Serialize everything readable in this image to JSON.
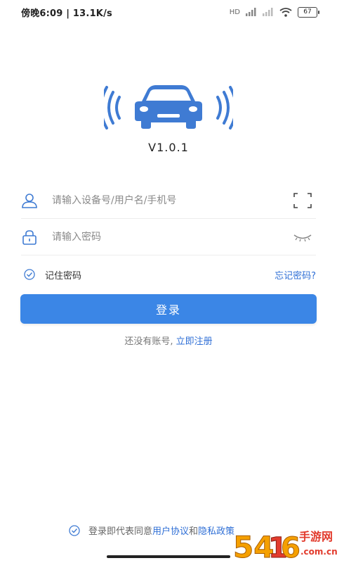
{
  "status_bar": {
    "left_text": "傍晚6:09 | 13.1K/s",
    "network_label": "HD",
    "battery_level": "67"
  },
  "app": {
    "version": "V1.0.1"
  },
  "login_form": {
    "username_placeholder": "请输入设备号/用户名/手机号",
    "password_placeholder": "请输入密码",
    "remember_label": "记住密码",
    "forgot_label": "忘记密码?",
    "login_label": "登录",
    "register_prompt": "还没有账号,",
    "register_link": "立即注册"
  },
  "agreement": {
    "prefix": "登录即代表同意",
    "user_agreement": "用户协议",
    "and": "和",
    "privacy_policy": "隐私政策"
  },
  "watermark": {
    "text_main": "54⬆6",
    "text_side": "手游网",
    "text_url": ".com.cn"
  },
  "colors": {
    "accent": "#3b86e6",
    "link": "#2f6fd6",
    "icon": "#3f7bd3"
  }
}
